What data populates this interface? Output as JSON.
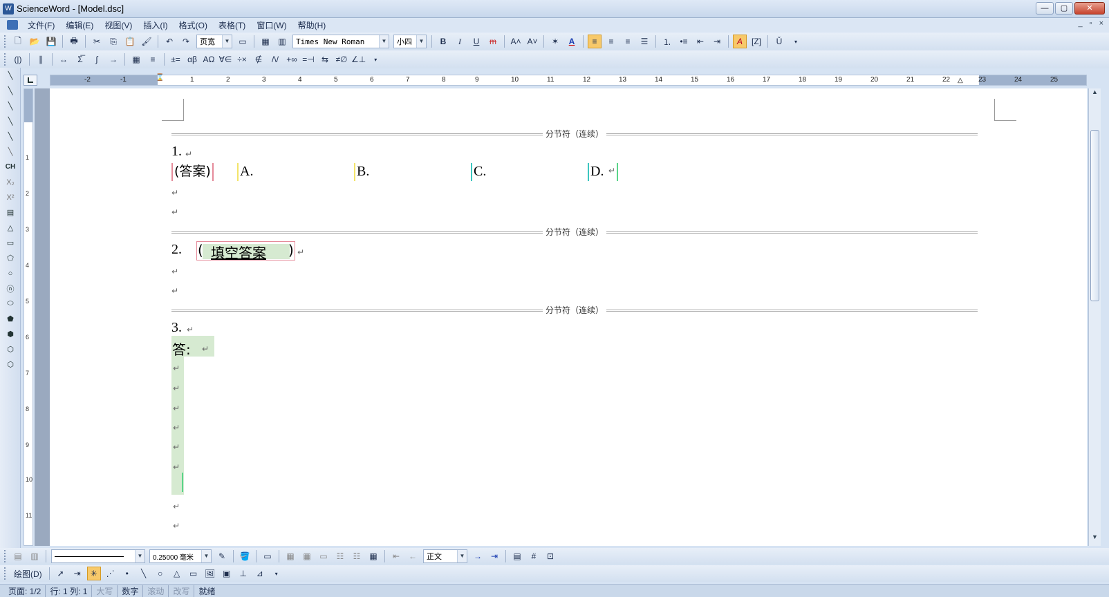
{
  "window": {
    "title": "ScienceWord - [Model.dsc]",
    "blurred_title": "",
    "buttons": {
      "minimize": "—",
      "maximize": "▢",
      "close": "✕"
    }
  },
  "menu": {
    "items": [
      "文件(F)",
      "编辑(E)",
      "视图(V)",
      "插入(I)",
      "格式(O)",
      "表格(T)",
      "窗口(W)",
      "帮助(H)"
    ],
    "mdi": [
      "_",
      "▫",
      "×"
    ]
  },
  "toolbar1": {
    "view_combo": "页宽",
    "font_combo": "Times New Roman",
    "size_combo": "小四",
    "buttons": [
      "new",
      "open",
      "save",
      "print",
      "cut",
      "copy",
      "paste",
      "format-painter",
      "undo",
      "redo",
      "page-layout",
      "table",
      "columns",
      "bold",
      "italic",
      "underline",
      "strike",
      "grow-font",
      "shrink-font",
      "symbol",
      "font-color",
      "align-left",
      "align-center",
      "align-right",
      "distribute",
      "numbering",
      "bullets",
      "decrease-indent",
      "increase-indent",
      "highlight",
      "frame",
      "chinese"
    ],
    "labels": {
      "bold": "B",
      "italic": "I",
      "underline": "U",
      "strike": "m",
      "grow": "A˄",
      "shrink": "A˅",
      "font_color": "A",
      "highlight": "A",
      "chinese": "Ǔ"
    }
  },
  "toolbar2": {
    "labels": [
      "(|)",
      "∥",
      "↔",
      "Σ̅",
      "∫",
      "→",
      "≡",
      "±=",
      "αβ",
      "ΑΩ",
      "∀∈",
      "÷×",
      "∉",
      "/\\/",
      "+∞",
      "=⊣",
      "⇆",
      "≠∅",
      "∠⊥"
    ]
  },
  "vtoolbar": {
    "labels": [
      "╲",
      "╲",
      "╲",
      "╲",
      "╲",
      "╲",
      "CH",
      "X₂",
      "X²",
      "▤",
      "△",
      "▭",
      "⬠",
      "○",
      "ⓝ",
      "⬭",
      "⬟",
      "⬢",
      "⬡",
      "⬡"
    ]
  },
  "hruler": {
    "numbers": [
      "-2",
      "-1",
      "1",
      "2",
      "3",
      "4",
      "5",
      "6",
      "7",
      "8",
      "9",
      "10",
      "11",
      "12",
      "13",
      "14",
      "15",
      "16",
      "17",
      "18",
      "19",
      "20",
      "21",
      "22",
      "23",
      "24",
      "25"
    ]
  },
  "vruler": {
    "numbers": [
      "1",
      "2",
      "3",
      "4",
      "5",
      "6",
      "7",
      "8",
      "9",
      "10",
      "11"
    ]
  },
  "document": {
    "section_break_label": "分节符（连续）",
    "para_mark": "↵",
    "q1": {
      "number": "1.",
      "answer_label": "(答案)",
      "options": [
        "A.",
        "B.",
        "C.",
        "D."
      ]
    },
    "q2": {
      "number": "2.",
      "fill_left": "(",
      "fill_text": "填空答案",
      "fill_right": ")"
    },
    "q3": {
      "number": "3.",
      "answer_prefix": "答:"
    }
  },
  "bottom_toolbar1": {
    "line_width": "0.25000 毫米",
    "style_combo": "正文"
  },
  "bottom_toolbar2": {
    "draw_label": "绘图(D)"
  },
  "status": {
    "page": "页面: 1/2",
    "row_col": "行: 1  列: 1",
    "caps": "大写",
    "num": "数字",
    "scroll": "滚动",
    "ovr": "改写",
    "ready": "就绪"
  },
  "colors": {
    "accent": "#3d6fb6",
    "answer_bg": "#d6ead1",
    "field_border_red": "#e58b9a",
    "field_border_yellow": "#f3e46a",
    "field_border_cyan": "#3cc6c0",
    "field_border_green": "#5ad58a"
  }
}
